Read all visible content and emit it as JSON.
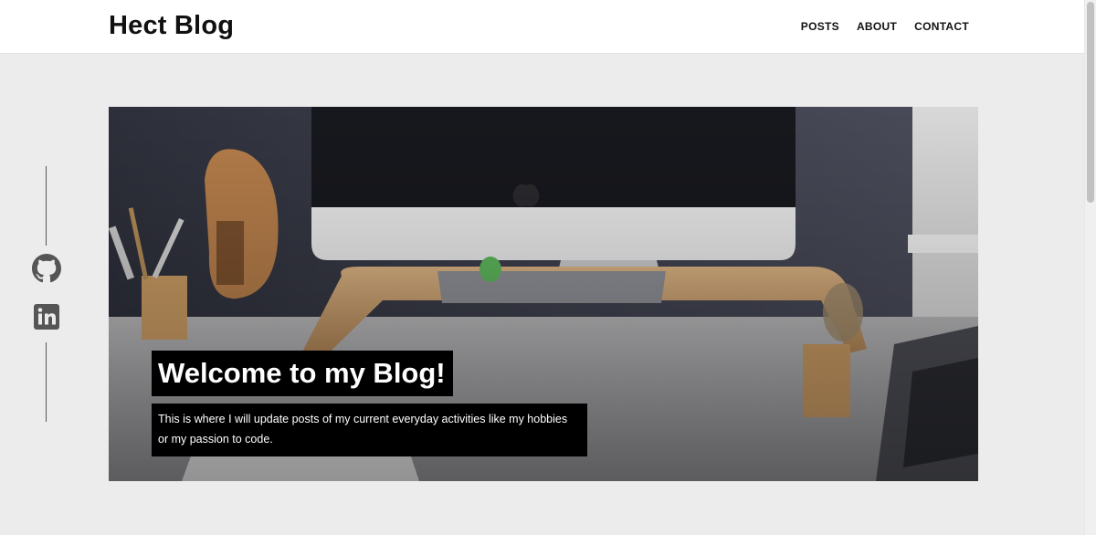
{
  "site": {
    "title": "Hect Blog"
  },
  "nav": {
    "items": [
      {
        "label": "POSTS"
      },
      {
        "label": "ABOUT"
      },
      {
        "label": "CONTACT"
      }
    ]
  },
  "social": {
    "links": [
      {
        "icon": "github-icon"
      },
      {
        "icon": "linkedin-icon"
      }
    ]
  },
  "hero": {
    "title": "Welcome to my Blog!",
    "description": "This is where I will update posts of my current everyday activities like my hobbies or my passion to code."
  },
  "colors": {
    "page_background": "#ececec",
    "header_background": "#ffffff",
    "caption_background": "#000000",
    "caption_text": "#ffffff",
    "icon_gray": "#555555"
  }
}
